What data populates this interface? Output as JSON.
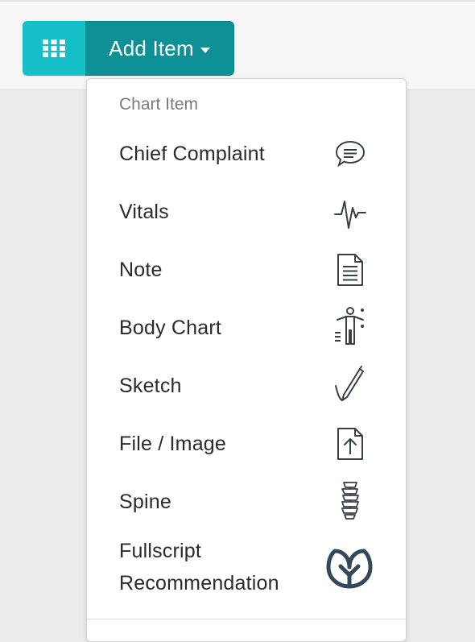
{
  "toolbar": {
    "grid_icon": "grid-icon",
    "add_item_label": "Add Item",
    "caret_icon": "caret-down-icon",
    "colors": {
      "grid_button": "#14bfc8",
      "add_button": "#0d9196"
    }
  },
  "menu": {
    "header": "Chart Item",
    "items": [
      {
        "label": "Chief Complaint",
        "icon": "speech-bubble-icon"
      },
      {
        "label": "Vitals",
        "icon": "heartbeat-icon"
      },
      {
        "label": "Note",
        "icon": "document-icon"
      },
      {
        "label": "Body Chart",
        "icon": "body-figure-icon"
      },
      {
        "label": "Sketch",
        "icon": "pen-icon"
      },
      {
        "label": "File / Image",
        "icon": "file-upload-icon"
      },
      {
        "label": "Spine",
        "icon": "spine-icon"
      },
      {
        "label_line1": "Fullscript",
        "label_line2": "Recommendation",
        "icon": "fullscript-leaf-icon"
      }
    ]
  }
}
